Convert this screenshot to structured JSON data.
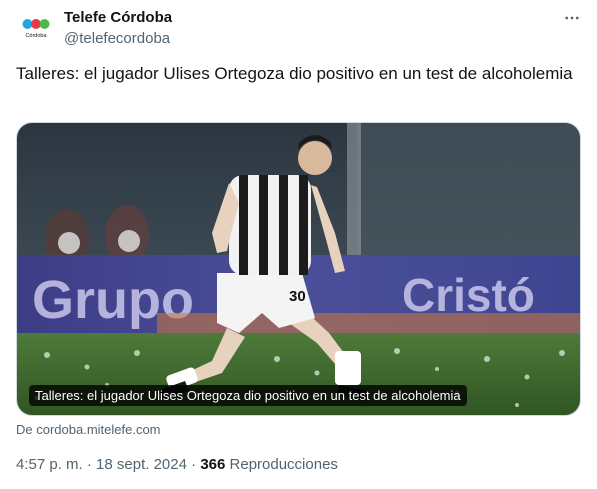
{
  "author": {
    "display_name": "Telefe Córdoba",
    "handle": "@telefecordoba",
    "avatar_label": "Córdoba",
    "avatar_dot_colors": [
      "#1fa7e3",
      "#e63a46",
      "#4cb948"
    ]
  },
  "tweet": {
    "text": "Talleres: el jugador Ulises Ortegoza dio positivo en un test de alcoholemia"
  },
  "media": {
    "headline_overlay": "Talleres: el jugador Ulises Ortegoza dio positivo en un test de alcoholemia",
    "board_text_left": "Grupo",
    "board_text_right": "Cristó",
    "jersey_number": "30",
    "source_link": "De cordoba.mitelefe.com"
  },
  "footer": {
    "time": "4:57 p. m.",
    "separator": "·",
    "date": "18 sept. 2024",
    "views_count": "366",
    "views_label": "Reproducciones"
  },
  "icons": {
    "more": "more-horizontal-icon"
  },
  "colors": {
    "text_primary": "#0f1419",
    "text_secondary": "#536471",
    "border": "#cfd9de"
  }
}
